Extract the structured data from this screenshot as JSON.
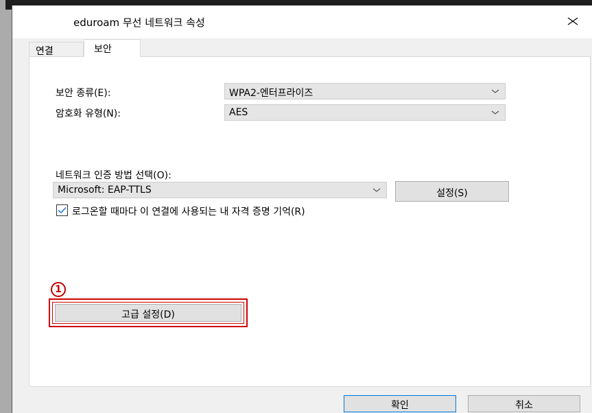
{
  "window": {
    "title": "eduroam 무선 네트워크 속성"
  },
  "tabs": [
    {
      "label": "연결"
    },
    {
      "label": "보안"
    }
  ],
  "security": {
    "type_label": "보안 종류(E):",
    "type_value": "WPA2-엔터프라이즈",
    "encryption_label": "암호화 유형(N):",
    "encryption_value": "AES",
    "auth_method_label": "네트워크 인증 방법 선택(O):",
    "auth_method_value": "Microsoft: EAP-TTLS",
    "settings_button": "설정(S)",
    "remember_label": "로그온할 때마다 이 연결에 사용되는 내 자격 증명 기억(R)",
    "remember_checked": true,
    "advanced_button": "고급 설정(D)"
  },
  "annotation": {
    "marker": "1",
    "color": "#d00000"
  },
  "footer": {
    "ok_label": "확인",
    "cancel_label": "취소"
  }
}
